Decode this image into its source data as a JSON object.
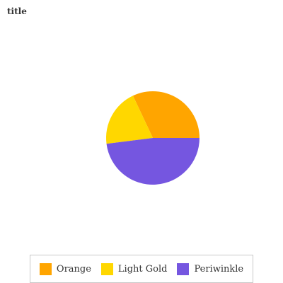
{
  "chart_data": {
    "type": "pie",
    "title": "title",
    "categories": [
      "Orange",
      "Light Gold",
      "Periwinkle"
    ],
    "values": [
      32,
      20,
      48
    ],
    "colors": [
      "#FFA500",
      "#FFD700",
      "#7556E0"
    ],
    "legend_position": "bottom",
    "start_angle_deg": 0,
    "direction": "clockwise"
  }
}
